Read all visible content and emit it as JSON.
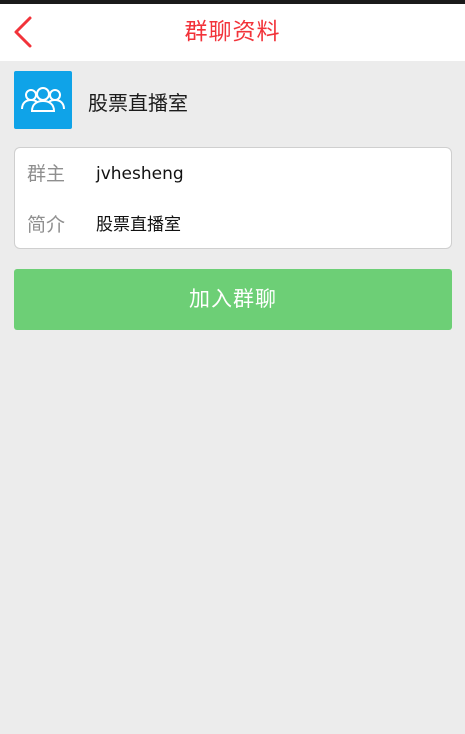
{
  "header": {
    "title": "群聊资料",
    "back_icon": "chevron-left-icon",
    "accent_color": "#f2333a"
  },
  "group": {
    "avatar_icon": "group-people-icon",
    "avatar_color": "#0fa3e8",
    "name": "股票直播室"
  },
  "details": {
    "owner_label": "群主",
    "owner_value": "jvhesheng",
    "intro_label": "简介",
    "intro_value": "股票直播室"
  },
  "actions": {
    "join_label": "加入群聊",
    "join_color": "#6dcf76"
  }
}
